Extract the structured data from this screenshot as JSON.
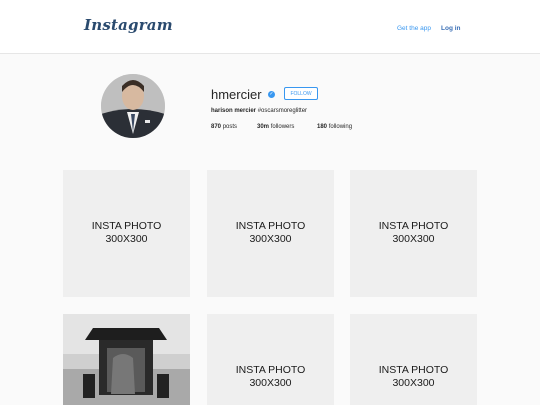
{
  "header": {
    "logo": "Instagram",
    "get_app": "Get the app",
    "login": "Log in"
  },
  "profile": {
    "username": "hmercier",
    "verified_icon": "verified-badge-icon",
    "follow_label": "FOLLOW",
    "full_name": "harison mercier",
    "bio_tag": "#oscarsmoreglitter",
    "posts_count": "870",
    "posts_label": "posts",
    "followers_count": "30m",
    "followers_label": "followers",
    "following_count": "180",
    "following_label": "following"
  },
  "grid": {
    "tiles": [
      {
        "line1": "INSTA PHOTO",
        "line2": "300X300"
      },
      {
        "line1": "INSTA PHOTO",
        "line2": "300X300"
      },
      {
        "line1": "INSTA PHOTO",
        "line2": "300X300"
      },
      {
        "line1": "",
        "line2": ""
      },
      {
        "line1": "INSTA PHOTO",
        "line2": "300X300"
      },
      {
        "line1": "INSTA PHOTO",
        "line2": "300X300"
      }
    ]
  },
  "colors": {
    "accent": "#3897f0",
    "placeholder": "#efefef",
    "background": "#fafafa"
  }
}
